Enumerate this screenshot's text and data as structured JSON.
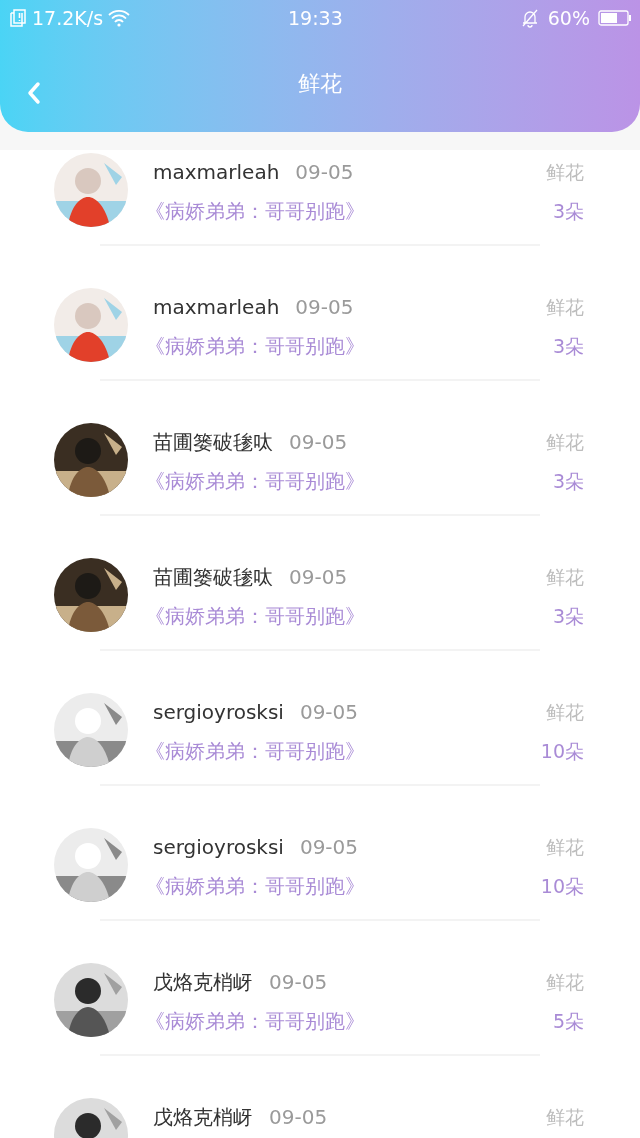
{
  "status_bar": {
    "network_speed": "17.2K/s",
    "time": "19:33",
    "battery": "60%"
  },
  "header": {
    "title": "鲜花"
  },
  "rows": [
    {
      "name": "maxmarleah",
      "date": "09-05",
      "book": "《病娇弟弟：哥哥别跑》",
      "type_label": "鲜花",
      "count": "3朵"
    },
    {
      "name": "maxmarleah",
      "date": "09-05",
      "book": "《病娇弟弟：哥哥别跑》",
      "type_label": "鲜花",
      "count": "3朵"
    },
    {
      "name": "苗圃篓破毶呔",
      "date": "09-05",
      "book": "《病娇弟弟：哥哥别跑》",
      "type_label": "鲜花",
      "count": "3朵"
    },
    {
      "name": "苗圃篓破毶呔",
      "date": "09-05",
      "book": "《病娇弟弟：哥哥别跑》",
      "type_label": "鲜花",
      "count": "3朵"
    },
    {
      "name": "sergioyrosksi",
      "date": "09-05",
      "book": "《病娇弟弟：哥哥别跑》",
      "type_label": "鲜花",
      "count": "10朵"
    },
    {
      "name": "sergioyrosksi",
      "date": "09-05",
      "book": "《病娇弟弟：哥哥别跑》",
      "type_label": "鲜花",
      "count": "10朵"
    },
    {
      "name": "戊烙克梢岈",
      "date": "09-05",
      "book": "《病娇弟弟：哥哥别跑》",
      "type_label": "鲜花",
      "count": "5朵"
    },
    {
      "name": "戊烙克梢岈",
      "date": "09-05",
      "type_label": "鲜花"
    }
  ]
}
